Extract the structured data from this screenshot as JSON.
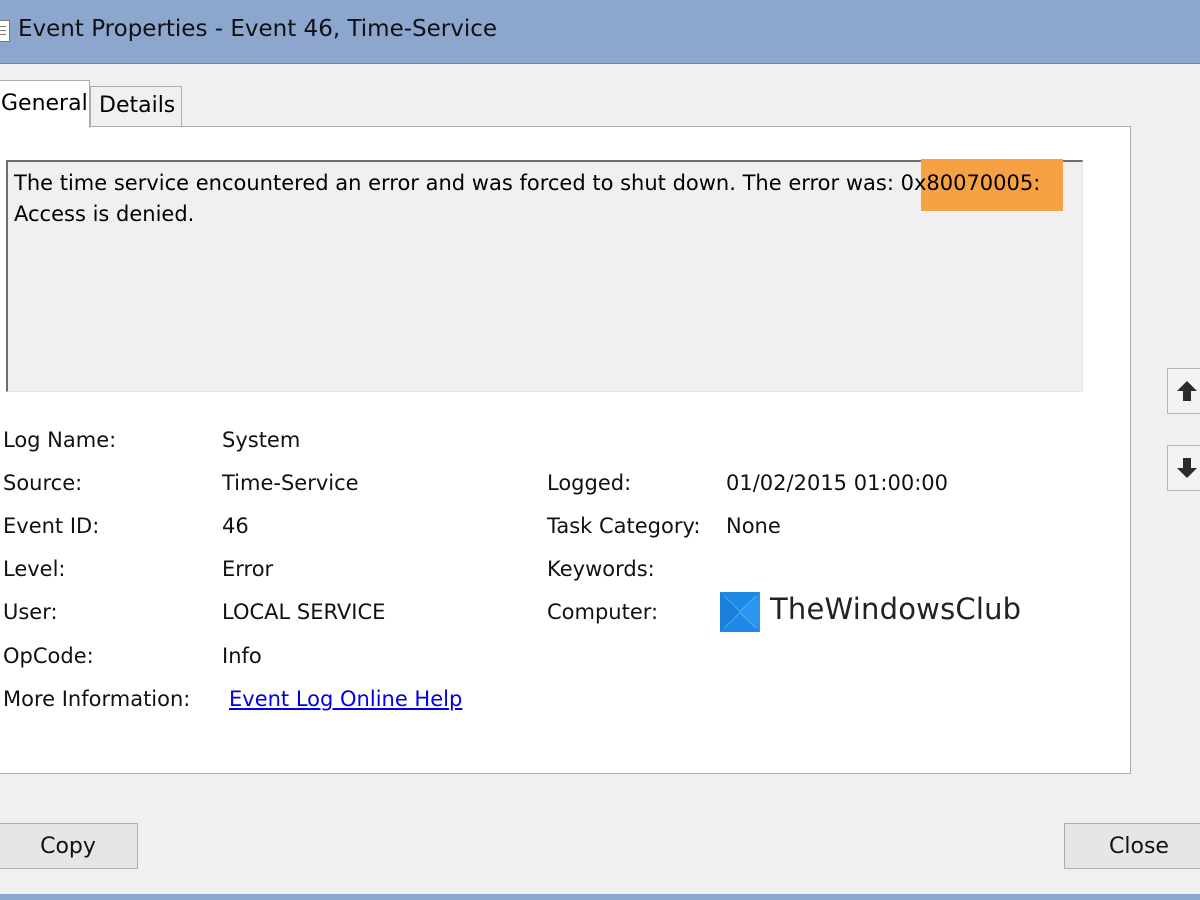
{
  "window": {
    "title": "Event Properties - Event 46, Time-Service"
  },
  "tabs": [
    {
      "label": "General",
      "active": true
    },
    {
      "label": "Details",
      "active": false
    }
  ],
  "message": {
    "text_before": "The time service encountered an error and was forced to shut down. The error was: ",
    "highlight": "0x80070005:",
    "text_after": "Access is denied.",
    "highlight_color": "#f6a244"
  },
  "fields": {
    "log_name": {
      "label": "Log Name:",
      "value": "System"
    },
    "source": {
      "label": "Source:",
      "value": "Time-Service"
    },
    "event_id": {
      "label": "Event ID:",
      "value": "46"
    },
    "level": {
      "label": "Level:",
      "value": "Error"
    },
    "user": {
      "label": "User:",
      "value": "LOCAL SERVICE"
    },
    "opcode": {
      "label": "OpCode:",
      "value": "Info"
    },
    "more_info": {
      "label": "More Information:",
      "value": "Event Log Online Help"
    },
    "logged": {
      "label": "Logged:",
      "value": "01/02/2015 01:00:00"
    },
    "task_category": {
      "label": "Task Category:",
      "value": "None"
    },
    "keywords": {
      "label": "Keywords:",
      "value": ""
    },
    "computer": {
      "label": "Computer:",
      "value": "TheWindowsClub"
    }
  },
  "buttons": {
    "copy": "Copy",
    "close": "Close"
  },
  "icons": {
    "prev": "arrow-up-icon",
    "next": "arrow-down-icon",
    "logo": "windows-logo-icon"
  },
  "colors": {
    "titlebar": "#8ca6cd",
    "link": "#0000e6",
    "logo": "#1e88e5"
  }
}
